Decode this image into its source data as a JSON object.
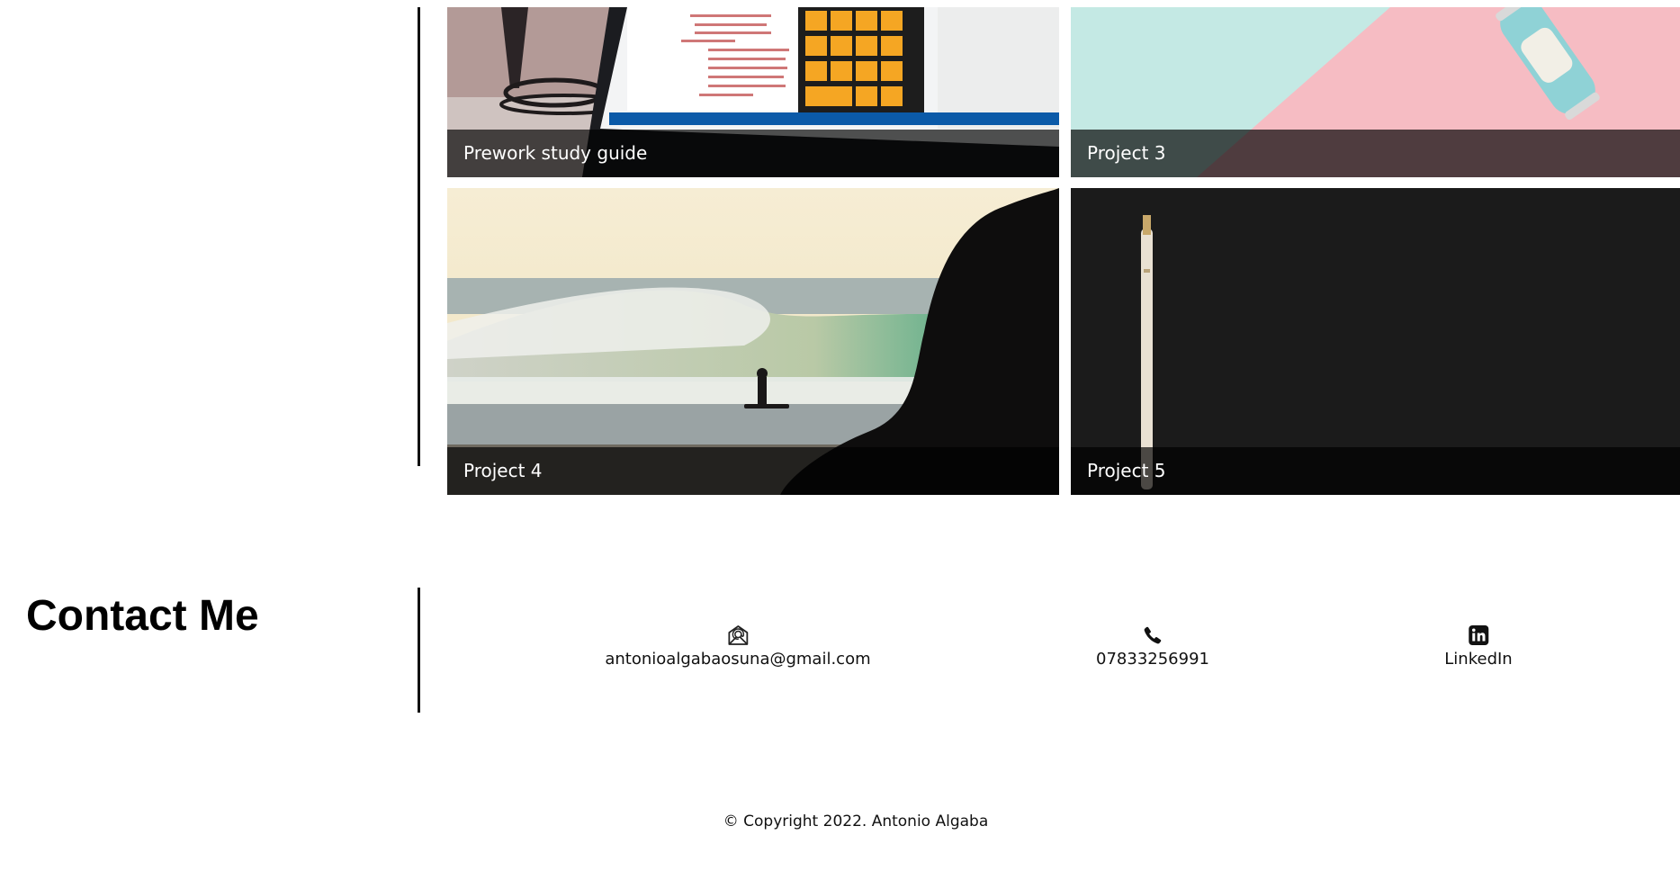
{
  "projects": [
    {
      "title": "Prework study guide",
      "image": "laptop-code-calculator"
    },
    {
      "title": "Project 3",
      "image": "toy-car-pastel"
    },
    {
      "title": "Project 4",
      "image": "surfer-beach-silhouette"
    },
    {
      "title": "Project 5",
      "image": "pencil-dark-background"
    }
  ],
  "contact": {
    "heading": "Contact Me",
    "email": {
      "icon": "envelope-at-icon",
      "label": "antonioalgabaosuna@gmail.com"
    },
    "phone": {
      "icon": "phone-icon",
      "label": "07833256991"
    },
    "linkedin": {
      "icon": "linkedin-icon",
      "label": "LinkedIn"
    }
  },
  "footer": {
    "copyright": "© Copyright 2022. Antonio Algaba"
  },
  "colors": {
    "caption_overlay": "#000000",
    "accent_orange": "#f5a623",
    "mint": "#bfe8e3",
    "pink": "#f6bcc3",
    "dark_bg": "#1c1c1c"
  }
}
